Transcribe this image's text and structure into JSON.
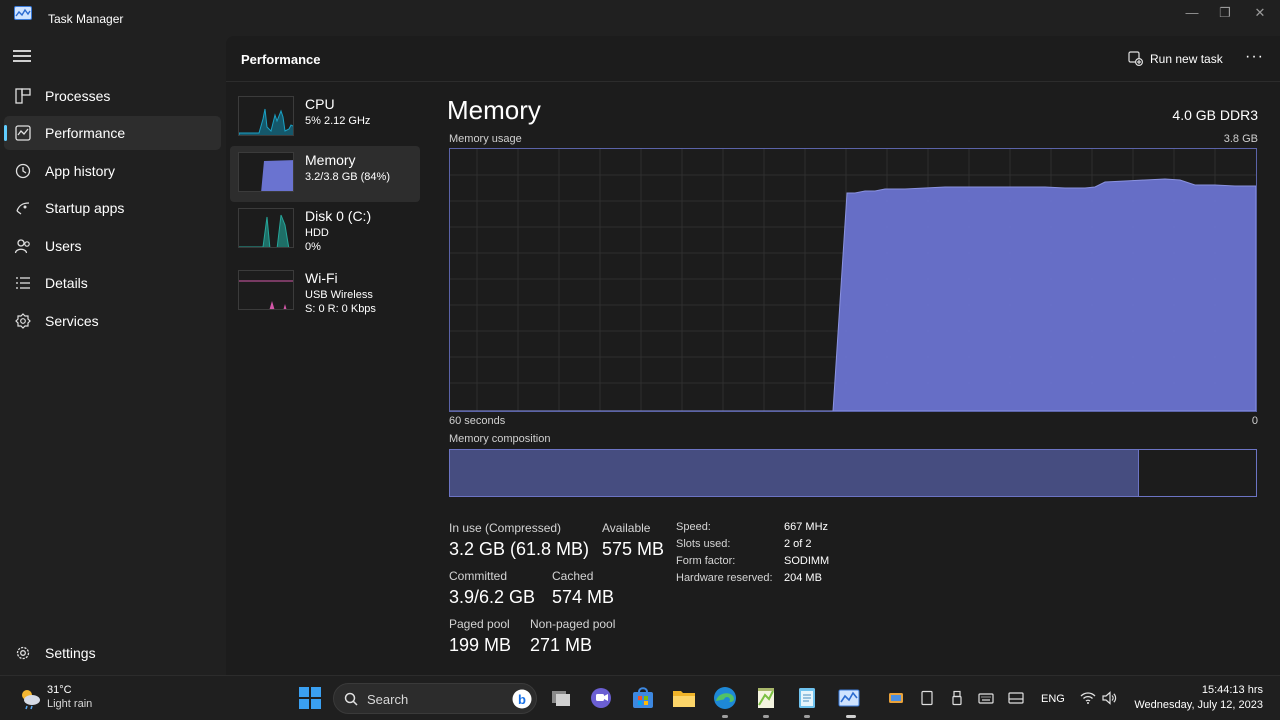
{
  "window": {
    "title": "Task Manager",
    "controls": [
      "minimize",
      "maximize",
      "close"
    ]
  },
  "sidebar": {
    "items": [
      {
        "label": "Processes",
        "icon": "processes-icon"
      },
      {
        "label": "Performance",
        "icon": "performance-icon",
        "active": true
      },
      {
        "label": "App history",
        "icon": "history-icon"
      },
      {
        "label": "Startup apps",
        "icon": "startup-icon"
      },
      {
        "label": "Users",
        "icon": "users-icon"
      },
      {
        "label": "Details",
        "icon": "details-icon"
      },
      {
        "label": "Services",
        "icon": "services-icon"
      }
    ],
    "settings_label": "Settings"
  },
  "header": {
    "title": "Performance",
    "run_task_label": "Run new task",
    "more_label": "···"
  },
  "resources": [
    {
      "name": "CPU",
      "line1": "5%  2.12 GHz",
      "line2": "",
      "color": "#1ba1c4"
    },
    {
      "name": "Memory",
      "line1": "3.2/3.8 GB (84%)",
      "line2": "",
      "color": "#6a73d0",
      "active": true
    },
    {
      "name": "Disk 0 (C:)",
      "line1": "HDD",
      "line2": "0%",
      "color": "#26a69a"
    },
    {
      "name": "Wi-Fi",
      "line1": "USB Wireless",
      "line2": "S: 0  R: 0 Kbps",
      "color": "#d257a8"
    }
  ],
  "detail": {
    "title": "Memory",
    "type": "4.0 GB DDR3",
    "usage_label": "Memory usage",
    "usage_max": "3.8 GB",
    "axis_left": "60 seconds",
    "axis_right": "0",
    "composition_label": "Memory composition",
    "composition_in_use_fraction": 0.855,
    "stats": {
      "in_use_label": "In use (Compressed)",
      "in_use_value": "3.2 GB (61.8 MB)",
      "available_label": "Available",
      "available_value": "575 MB",
      "committed_label": "Committed",
      "committed_value": "3.9/6.2 GB",
      "cached_label": "Cached",
      "cached_value": "574 MB",
      "paged_label": "Paged pool",
      "paged_value": "199 MB",
      "nonpaged_label": "Non-paged pool",
      "nonpaged_value": "271 MB"
    },
    "specs": [
      {
        "key": "Speed:",
        "value": "667 MHz"
      },
      {
        "key": "Slots used:",
        "value": "2 of 2"
      },
      {
        "key": "Form factor:",
        "value": "SODIMM"
      },
      {
        "key": "Hardware reserved:",
        "value": "204 MB"
      }
    ]
  },
  "taskbar": {
    "weather_temp": "31°C",
    "weather_desc": "Light rain",
    "search_label": "Search",
    "apps": [
      "windows-start-icon",
      "bing-icon",
      "task-view-icon",
      "teams-chat-icon",
      "store-icon",
      "file-explorer-icon",
      "edge-icon",
      "notepad-plus-icon",
      "notepad-icon",
      "task-manager-icon"
    ],
    "tray": [
      "photos-icon",
      "tablet-icon",
      "usb-icon",
      "keyboard-icon",
      "display-icon",
      "wifi-icon",
      "volume-icon"
    ],
    "language": "ENG",
    "time": "15:44:13 hrs",
    "date": "Wednesday, July 12, 2023"
  }
}
